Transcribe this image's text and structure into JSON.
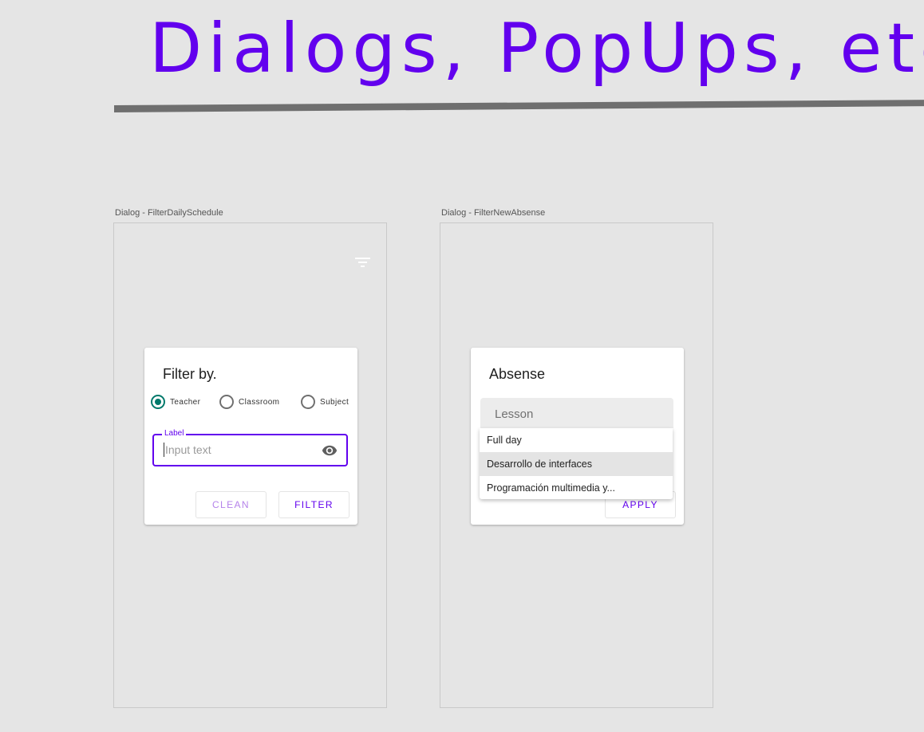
{
  "page_title": "Dialogs, PopUps, etc",
  "colors": {
    "accent": "#6200ee",
    "radio_checked": "#00796b",
    "background": "#e5e5e5",
    "rule": "#6f6f6f"
  },
  "frames": [
    {
      "label": "Dialog - FilterDailySchedule",
      "toolbar_icon": "filter-list-icon",
      "dialog": {
        "title": "Filter by.",
        "radios": [
          {
            "label": "Teacher",
            "checked": true
          },
          {
            "label": "Classroom",
            "checked": false
          },
          {
            "label": "Subject",
            "checked": false
          }
        ],
        "text_field": {
          "label": "Label",
          "placeholder": "Input text",
          "trailing_icon": "eye-icon"
        },
        "buttons": {
          "clean": "CLEAN",
          "filter": "FILTER"
        }
      }
    },
    {
      "label": "Dialog - FilterNewAbsense",
      "dialog": {
        "title": "Absense",
        "select": {
          "placeholder": "Lesson",
          "options": [
            "Full day",
            "Desarrollo de interfaces",
            "Programación multimedia y..."
          ],
          "highlighted_index": 1
        },
        "buttons": {
          "apply": "APPLY"
        }
      }
    }
  ]
}
